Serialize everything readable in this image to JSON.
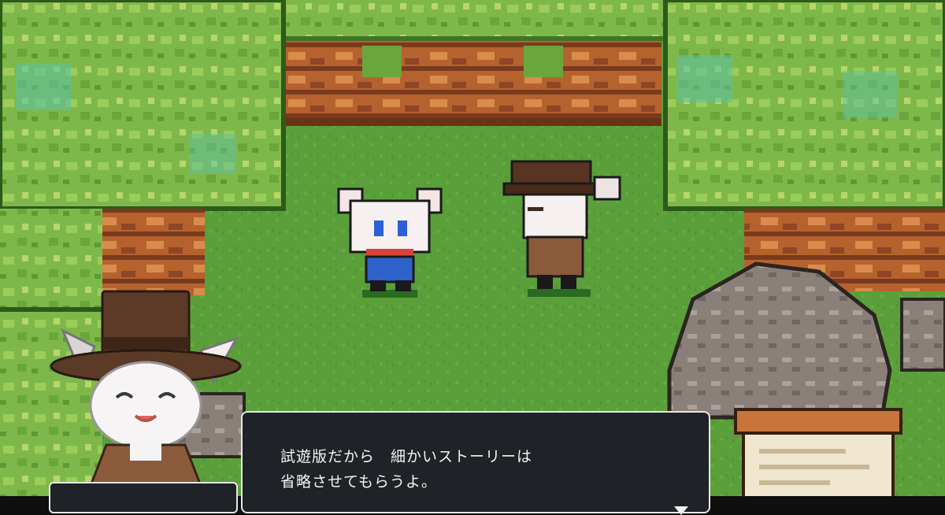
{
  "dialog": {
    "lines": [
      "試遊版だから　細かいストーリーは",
      "省略させてもらうよ。"
    ]
  },
  "speaker": {
    "name": ""
  },
  "colors": {
    "grass": "#5a9f3a",
    "tree_leaf": "#7fb84a",
    "tree_leaf_dark": "#4d8a2e",
    "cliff": "#b5622f",
    "rock": "#8a8079",
    "dialog_bg": "#1f2226",
    "dialog_border": "#e8e8e8"
  },
  "icons": {
    "dialog_advance": "triangle-down-icon"
  }
}
